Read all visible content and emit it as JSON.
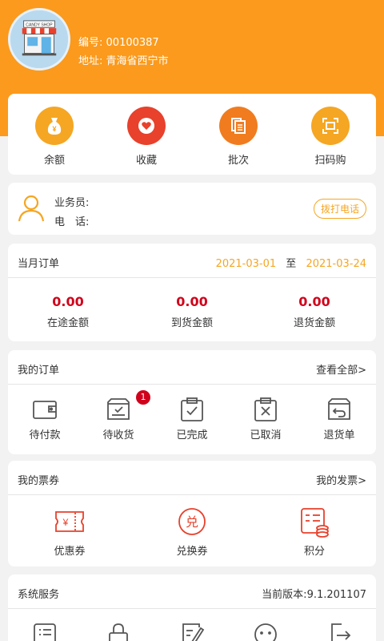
{
  "header": {
    "code_label": "编号:",
    "code_value": "00100387",
    "addr_label": "地址:",
    "addr_value": "青海省西宁市",
    "logo_text": "CANDY SHOP"
  },
  "quick_actions": [
    {
      "label": "余额",
      "icon": "money-bag-icon",
      "color": "#f5a623"
    },
    {
      "label": "收藏",
      "icon": "heart-icon",
      "color": "#e8412c"
    },
    {
      "label": "批次",
      "icon": "batch-icon",
      "color": "#f07c1f"
    },
    {
      "label": "扫码购",
      "icon": "scan-icon",
      "color": "#f5a623"
    }
  ],
  "salesperson": {
    "rep_label": "业务员:",
    "phone_label": "电　话:",
    "call_button": "拨打电话"
  },
  "monthly": {
    "title": "当月订单",
    "date_from": "2021-03-01",
    "to_label": "至",
    "date_to": "2021-03-24",
    "amounts": [
      {
        "value": "0.00",
        "label": "在途金额"
      },
      {
        "value": "0.00",
        "label": "到货金额"
      },
      {
        "value": "0.00",
        "label": "退货金额"
      }
    ]
  },
  "my_orders": {
    "title": "我的订单",
    "view_all": "查看全部>",
    "items": [
      {
        "label": "待付款",
        "icon": "wallet-icon"
      },
      {
        "label": "待收货",
        "icon": "delivery-box-icon",
        "badge": "1"
      },
      {
        "label": "已完成",
        "icon": "clipboard-check-icon"
      },
      {
        "label": "已取消",
        "icon": "clipboard-x-icon"
      },
      {
        "label": "退货单",
        "icon": "return-box-icon"
      }
    ]
  },
  "my_tickets": {
    "title": "我的票券",
    "invoice_link": "我的发票>",
    "items": [
      {
        "label": "优惠券",
        "icon": "coupon-icon"
      },
      {
        "label": "兑换券",
        "icon": "exchange-icon",
        "glyph": "兑"
      },
      {
        "label": "积分",
        "icon": "points-icon"
      }
    ],
    "coupon_glyph": "¥"
  },
  "system": {
    "title": "系统服务",
    "version_label": "当前版本:",
    "version_value": "9.1.201107",
    "items": [
      {
        "icon": "list-icon"
      },
      {
        "icon": "lock-icon"
      },
      {
        "icon": "edit-icon"
      },
      {
        "icon": "chat-icon"
      },
      {
        "icon": "logout-icon"
      }
    ]
  }
}
